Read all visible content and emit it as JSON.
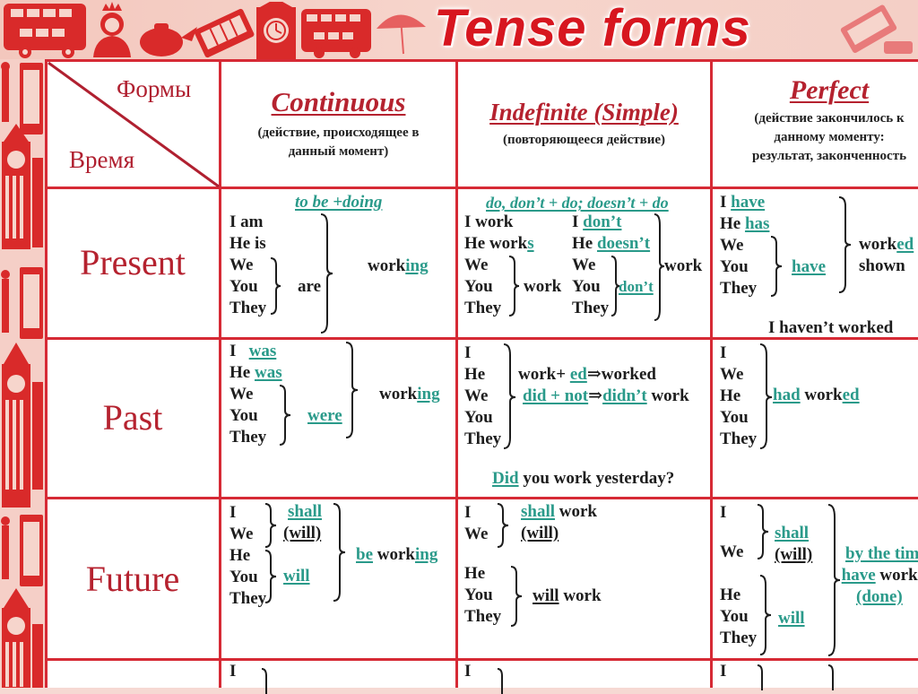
{
  "title": "Tense forms",
  "corner": {
    "forms_label": "Формы",
    "time_label": "Время"
  },
  "columns": [
    {
      "title": "Continuous",
      "subtitle_lines": [
        "(действие, происходящее в",
        "данный момент)"
      ]
    },
    {
      "title": "Indefinite (Simple)",
      "subtitle_lines": [
        "(повторяющееся действие)"
      ]
    },
    {
      "title": "Perfect",
      "subtitle_lines": [
        "(действие закончилось к",
        "данному моменту:",
        "результат, законченность"
      ]
    }
  ],
  "rows": [
    "Present",
    "Past",
    "Future"
  ],
  "present": {
    "continuous": {
      "formula": "to be +doing",
      "subjects": [
        "I am",
        "He is",
        "We",
        "You",
        "They"
      ],
      "are": "are",
      "verb_stem": "work",
      "verb_suffix": "ing"
    },
    "simple": {
      "formula": "do, don’t + do; doesn’t + do",
      "aff_1": "I work",
      "aff_2_stem": "He work",
      "aff_2_suffix": "s",
      "aff_plural": [
        "We",
        "You",
        "They"
      ],
      "aff_plural_verb": "work",
      "neg_1_subj": "I",
      "neg_1_aux": "don’t",
      "neg_2_subj": "He",
      "neg_2_aux": "doesn’t",
      "neg_plural": [
        "We",
        "You",
        "They"
      ],
      "neg_plural_aux": "don’t",
      "neg_verb": "work"
    },
    "perfect": {
      "s1": "I",
      "aux1": "have",
      "s2": "He",
      "aux2": "has",
      "plural": [
        "We",
        "You",
        "They"
      ],
      "plural_aux": "have",
      "verb_stem": "work",
      "verb_suffix": "ed",
      "verb_2": "shown",
      "negative": "I haven’t worked"
    }
  },
  "past": {
    "continuous": {
      "s1": "I",
      "aux1": "was",
      "s2": "He",
      "aux2": "was",
      "plural": [
        "We",
        "You",
        "They"
      ],
      "plural_aux": "were",
      "verb_stem": "work",
      "verb_suffix": "ing"
    },
    "simple": {
      "subjects": [
        "I",
        "He",
        "We",
        "You",
        "They"
      ],
      "rule_1_a": "work+ ",
      "rule_1_b": "ed",
      "rule_1_arrow": "⇒",
      "rule_1_c": "worked",
      "rule_2_a": "did + not",
      "rule_2_arrow": "⇒",
      "rule_2_b": "didn’t",
      "rule_2_c": " work",
      "question_aux": "Did",
      "question_rest": " you work yesterday?"
    },
    "perfect": {
      "subjects": [
        "I",
        "We",
        "He",
        "You",
        "They"
      ],
      "aux": "had",
      "verb_stem": " work",
      "verb_suffix": "ed"
    }
  },
  "future": {
    "continuous": {
      "group1": [
        "I",
        "We"
      ],
      "group2": [
        "He",
        "You",
        "They"
      ],
      "aux1": "shall",
      "aux1_alt": "(will)",
      "aux2": "will",
      "be": "be",
      "verb_stem": " work",
      "verb_suffix": "ing"
    },
    "simple": {
      "group1": [
        "I",
        "We"
      ],
      "aux1": "shall",
      "verb1": " work",
      "aux1_alt": "(will)",
      "group2": [
        "He",
        "You",
        "They"
      ],
      "aux2": "will",
      "verb2": " work"
    },
    "perfect": {
      "group1": [
        "I",
        "We"
      ],
      "aux1": "shall",
      "aux1_alt": "(will)",
      "group2": [
        "He",
        "You",
        "They"
      ],
      "aux2": "will",
      "line_1": "by the tim",
      "line_2_aux": "have",
      "line_2_verb": " work",
      "line_3": "(done)"
    }
  },
  "next_row_partial": {
    "col1_subject": "I",
    "col2_subject": "I",
    "col3_subject": "I"
  },
  "colors": {
    "grid": "#d62a35",
    "title": "#d7161f",
    "header_text": "#b5222f",
    "highlight": "#2a9a8a",
    "body_text": "#1d1d1d"
  }
}
